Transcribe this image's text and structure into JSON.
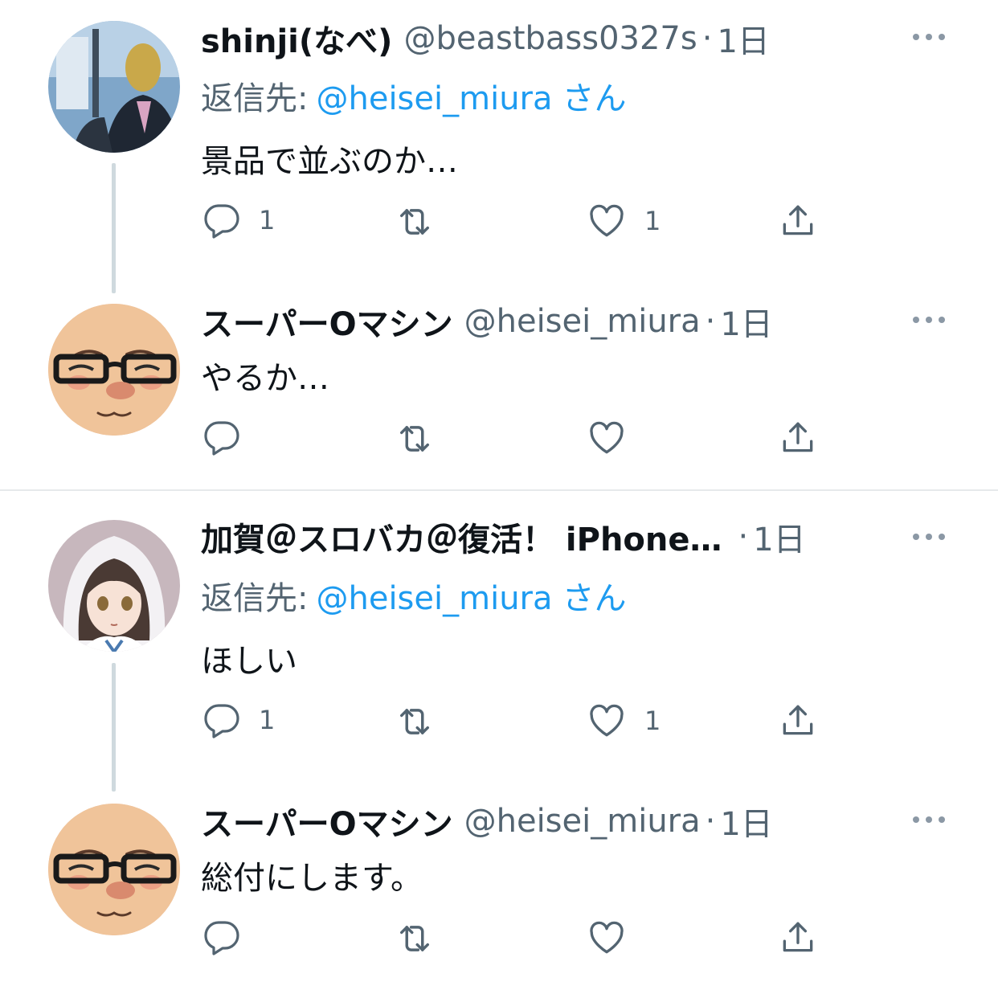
{
  "colors": {
    "link": "#1d9bf0",
    "secondary": "#536471",
    "thread_line": "#cfd9de"
  },
  "tweets": [
    {
      "name": "shinji(なべ)",
      "handle": "@beastbass0327s",
      "sep": "·",
      "time": "1日",
      "reply_prefix": "返信先:",
      "reply_handle": "@heisei_miura",
      "reply_suffix": "さん",
      "text": "景品で並ぶのか…",
      "reply_count": "1",
      "retweet_count": "",
      "like_count": "1",
      "avatar": "photo-avatar"
    },
    {
      "name": "スーパーOマシン",
      "handle": "@heisei_miura",
      "sep": "·",
      "time": "1日",
      "text": "やるか…",
      "reply_count": "",
      "retweet_count": "",
      "like_count": "",
      "avatar": "glasses-face-avatar"
    },
    {
      "name": "加賀＠スロバカ＠復活！ iPhone…",
      "handle": "",
      "sep": "·",
      "time": "1日",
      "reply_prefix": "返信先:",
      "reply_handle": "@heisei_miura",
      "reply_suffix": "さん",
      "text": "ほしい",
      "reply_count": "1",
      "retweet_count": "",
      "like_count": "1",
      "avatar": "anime-girl-avatar"
    },
    {
      "name": "スーパーOマシン",
      "handle": "@heisei_miura",
      "sep": "·",
      "time": "1日",
      "text": "総付にします。",
      "reply_count": "",
      "retweet_count": "",
      "like_count": "",
      "avatar": "glasses-face-avatar"
    }
  ],
  "icons": [
    "reply-icon",
    "retweet-icon",
    "like-icon",
    "share-icon",
    "more-icon"
  ]
}
